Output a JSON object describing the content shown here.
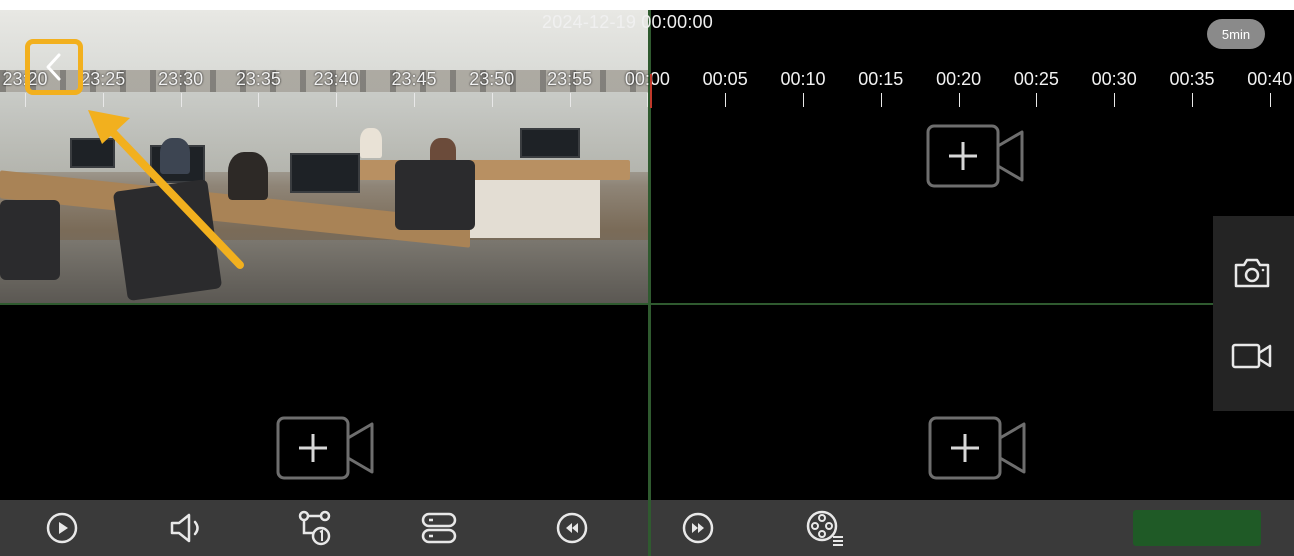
{
  "timeline": {
    "date_time": "2024-12-19 00:00:00",
    "interval": "5min",
    "ticks": [
      "23:20",
      "23:25",
      "23:30",
      "23:35",
      "23:40",
      "23:45",
      "23:50",
      "23:55",
      "00:00",
      "00:05",
      "00:10",
      "00:15",
      "00:20",
      "00:25",
      "00:30",
      "00:35",
      "00:40"
    ]
  },
  "icons": {
    "back": "chevron-left-icon",
    "add_camera": "add-camera-icon",
    "snapshot": "camera-icon",
    "record": "video-icon",
    "toolbar": [
      "play-icon",
      "volume-icon",
      "stream-switch-icon",
      "storage-icon",
      "rewind-icon",
      "fast-forward-icon",
      "film-reel-icon"
    ]
  },
  "colors": {
    "highlight": "#f2b01e",
    "grid_divider": "#2f5a2f",
    "cursor": "#c0392b",
    "toolbar": "#3a3a3a"
  }
}
